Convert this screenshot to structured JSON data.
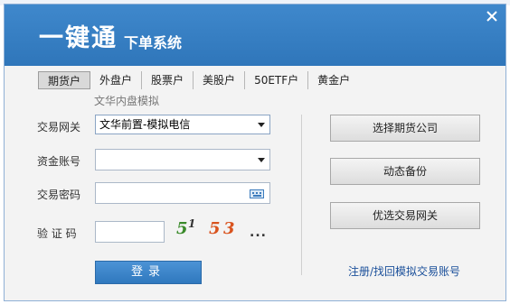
{
  "header": {
    "brand": "一键通",
    "subtitle": "下单系统",
    "close_icon": "close-icon"
  },
  "tabs": [
    {
      "label": "期货户",
      "active": true
    },
    {
      "label": "外盘户",
      "active": false
    },
    {
      "label": "股票户",
      "active": false
    },
    {
      "label": "美股户",
      "active": false
    },
    {
      "label": "50ETF户",
      "active": false
    },
    {
      "label": "黄金户",
      "active": false
    }
  ],
  "form": {
    "hint": "文华内盘模拟",
    "gateway_label": "交易网关",
    "gateway_value": "文华前置-模拟电信",
    "account_label": "资金账号",
    "account_value": "",
    "password_label": "交易密码",
    "password_value": "",
    "keyboard_icon": "keyboard-icon",
    "captcha_label": "验 证 码",
    "captcha_value": "",
    "captcha_image": {
      "c1": "5",
      "c2": "1",
      "c3": "5",
      "c4": "3"
    },
    "refresh_label": "...",
    "login_label": "登录"
  },
  "right_panel": {
    "select_company": "选择期货公司",
    "dynamic_backup": "动态备份",
    "preferred_gateway": "优选交易网关",
    "register_link": "注册/找回模拟交易账号"
  },
  "colors": {
    "header_blue": "#3580c4",
    "login_blue": "#3a85cc",
    "link_blue": "#1a4f9a"
  }
}
